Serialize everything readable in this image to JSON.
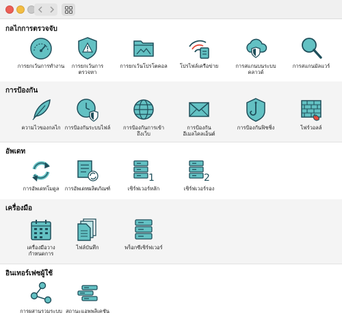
{
  "colors": {
    "icon_fill": "#63c1c3",
    "icon_stroke": "#1f4e5a",
    "accent_red": "#e24b3b"
  },
  "sections": [
    {
      "title": "กลไกการตรวจจับ",
      "items": [
        {
          "label": "การยกเว้นการทำงาน",
          "icon": "speedometer-icon"
        },
        {
          "label": "การยกเว้นการ\nตรวจหา",
          "icon": "warning-shield-icon"
        },
        {
          "label": "การยกเว้นโปรโตคอล",
          "icon": "folder-icon"
        },
        {
          "label": "โปรไฟล์เครือข่าย",
          "icon": "wifi-network-icon"
        },
        {
          "label": "การสแกนบนระบบ\nคลาวด์",
          "icon": "cloud-shield-icon"
        },
        {
          "label": "การสแกนมัลแวร์",
          "icon": "magnifier-icon"
        }
      ]
    },
    {
      "title": "การป้องกัน",
      "items": [
        {
          "label": "ความไวของกลไก",
          "icon": "feather-icon"
        },
        {
          "label": "การป้องกันระบบไฟล์",
          "icon": "clock-shield-icon"
        },
        {
          "label": "การป้องกันการเข้า\nถึงเว็บ",
          "icon": "globe-icon"
        },
        {
          "label": "การป้องกัน\nอีเมลไคลเอ็นต์",
          "icon": "envelope-icon"
        },
        {
          "label": "การป้องกันฟิชชิ่ง",
          "icon": "phishing-hook-icon"
        },
        {
          "label": "ไฟร์วอลล์",
          "icon": "firewall-icon"
        }
      ]
    },
    {
      "title": "อัพเดท",
      "items": [
        {
          "label": "การอัพเดทโมดูล",
          "icon": "refresh-icon"
        },
        {
          "label": "การอัพเดทผลิตภัณฑ์",
          "icon": "product-update-icon"
        },
        {
          "label": "เซิร์ฟเวอร์หลัก",
          "icon": "server-primary-icon",
          "badge": "1"
        },
        {
          "label": "เซิร์ฟเวอร์รอง",
          "icon": "server-secondary-icon",
          "badge": "2"
        }
      ]
    },
    {
      "title": "เครื่องมือ",
      "items": [
        {
          "label": "เครื่องมือวาง\nกำหนดการ",
          "icon": "calendar-icon"
        },
        {
          "label": "ไฟล์บันทึก",
          "icon": "log-files-icon"
        },
        {
          "label": "พร็อกซีเซิร์ฟเวอร์",
          "icon": "proxy-server-icon"
        }
      ]
    },
    {
      "title": "อินเทอร์เฟซผู้ใช้",
      "items": [
        {
          "label": "การผสานรวมระบบ",
          "icon": "share-nodes-icon"
        },
        {
          "label": "สถานะแอพพลิเคชัน",
          "icon": "status-bars-icon"
        }
      ]
    }
  ]
}
